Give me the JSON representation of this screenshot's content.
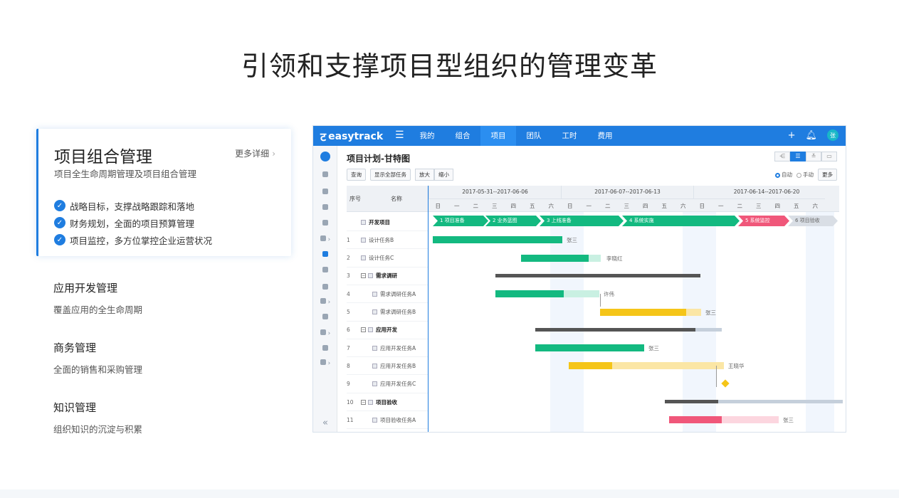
{
  "page": {
    "title": "引领和支撑项目型组织的管理变革"
  },
  "featured": {
    "title": "项目组合管理",
    "more": "更多详细",
    "subtitle": "项目全生命周期管理及项目组合管理",
    "points": [
      "战略目标，支撑战略跟踪和落地",
      "财务规划，全面的项目预算管理",
      "项目监控，多方位掌控企业运营状况"
    ]
  },
  "modules": [
    {
      "title": "应用开发管理",
      "subtitle": "覆盖应用的全生命周期"
    },
    {
      "title": "商务管理",
      "subtitle": "全面的销售和采购管理"
    },
    {
      "title": "知识管理",
      "subtitle": "组织知识的沉淀与积累"
    }
  ],
  "app": {
    "brand": "easytrack",
    "nav": [
      "我的",
      "组合",
      "项目",
      "团队",
      "工时",
      "费用"
    ],
    "nav_active_index": 2,
    "avatar_text": "张",
    "page_title": "项目计划-甘特图",
    "buttons": {
      "query": "查询",
      "show_all": "显示全部任务",
      "zoom_in": "放大",
      "zoom_out": "缩小",
      "more": "更多"
    },
    "modes": {
      "auto": "自动",
      "manual": "手动"
    },
    "columns": {
      "no": "序号",
      "name": "名称"
    },
    "weeks": [
      "2017-05-31--2017-06-06",
      "2017-06-07--2017-06-13",
      "2017-06-14--2017-06-20"
    ],
    "days": [
      "日",
      "一",
      "二",
      "三",
      "四",
      "五",
      "六",
      "日",
      "一",
      "二",
      "三",
      "四",
      "五",
      "六",
      "日",
      "一",
      "二",
      "三",
      "四",
      "五",
      "六"
    ],
    "rows": [
      {
        "no": "",
        "name": "开发项目",
        "bold": true
      },
      {
        "no": "1",
        "name": "设计任务B"
      },
      {
        "no": "2",
        "name": "设计任务C"
      },
      {
        "no": "3",
        "name": "需求调研",
        "bold": true,
        "group": true
      },
      {
        "no": "4",
        "name": "需求调研任务A",
        "indent": true
      },
      {
        "no": "5",
        "name": "需求调研任务B",
        "indent": true
      },
      {
        "no": "6",
        "name": "应用开发",
        "bold": true,
        "group": true
      },
      {
        "no": "7",
        "name": "应用开发任务A",
        "indent": true
      },
      {
        "no": "8",
        "name": "应用开发任务B",
        "indent": true
      },
      {
        "no": "9",
        "name": "应用开发任务C",
        "indent": true
      },
      {
        "no": "10",
        "name": "项目验收",
        "bold": true,
        "group": true
      },
      {
        "no": "11",
        "name": "项目验收任务A",
        "indent": true
      }
    ],
    "phases": [
      "1 项目准备",
      "2 业务蓝图",
      "3 上线准备",
      "4 系统实施",
      "5 系统监控",
      "6 项目验收"
    ],
    "assignees": [
      "张三",
      "李晓红",
      "许伟",
      "张三",
      "张三",
      "王晓华",
      "张三"
    ],
    "colors": {
      "primary": "#1f7de0",
      "green": "#13b980",
      "yellow": "#f5c518",
      "red": "#f0577a",
      "gray": "#555555"
    }
  }
}
